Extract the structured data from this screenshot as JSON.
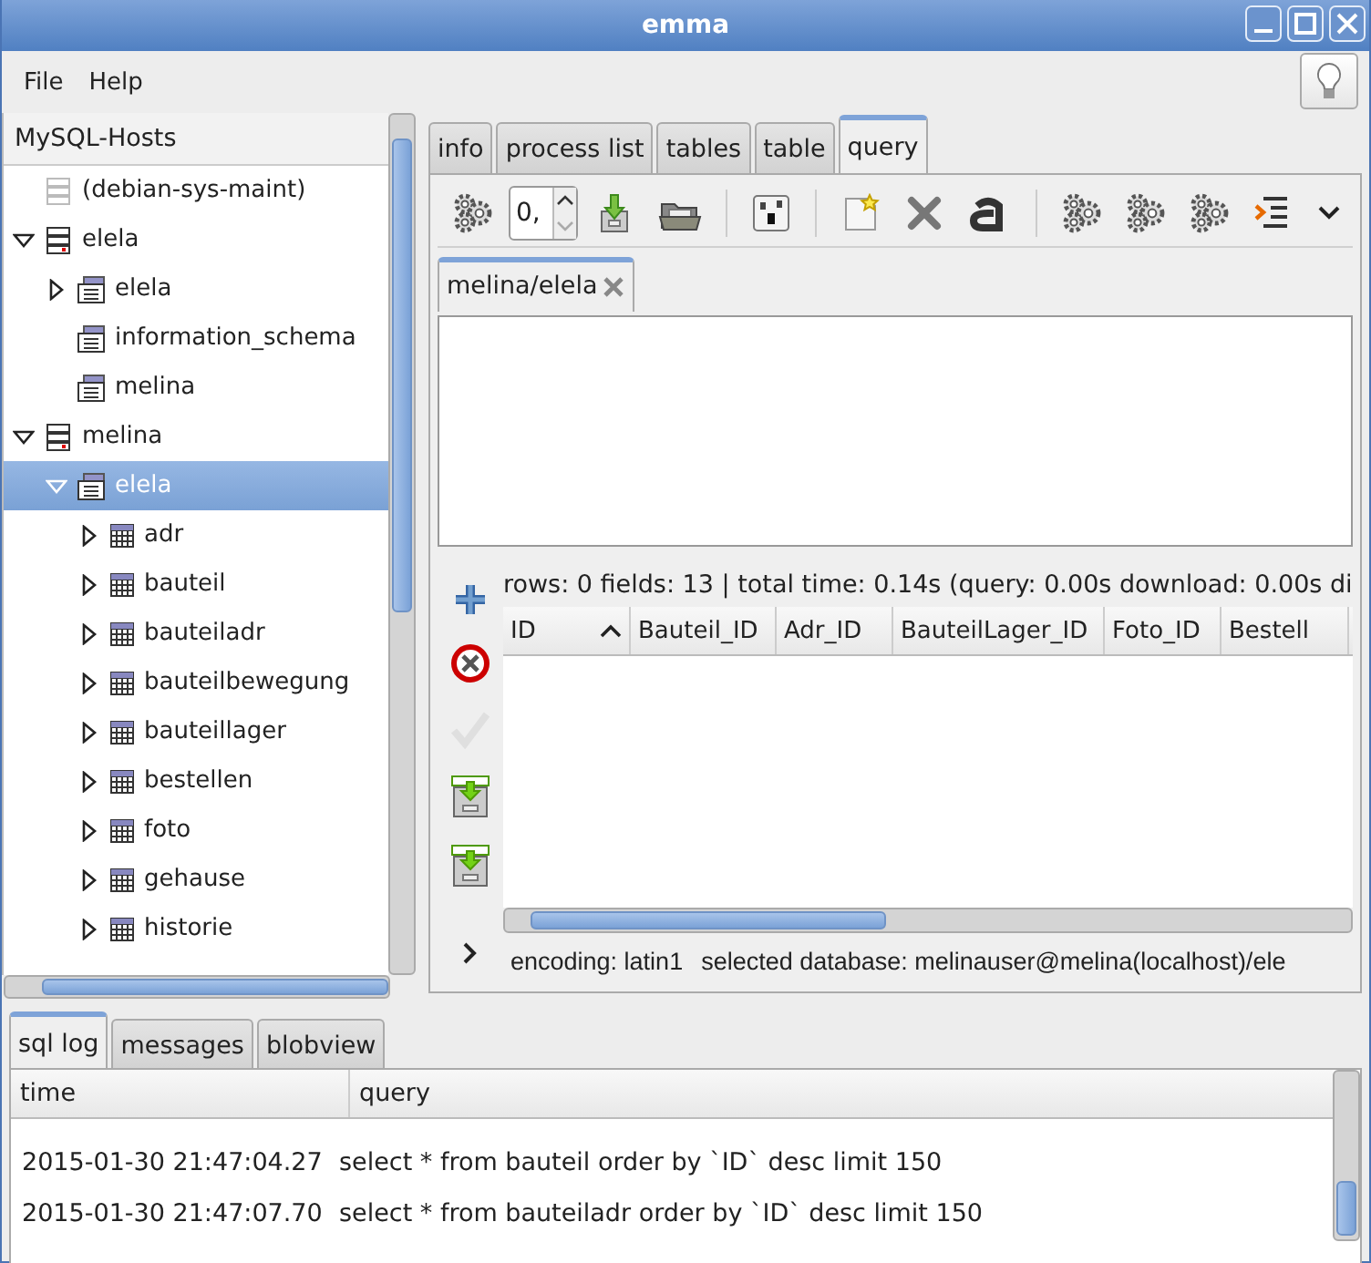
{
  "window": {
    "title": "emma"
  },
  "menu": [
    {
      "label": "File"
    },
    {
      "label": "Help"
    }
  ],
  "hosts_panel": {
    "title": "MySQL-Hosts",
    "tree": [
      {
        "label": "(debian-sys-maint)",
        "kind": "host",
        "disabled": true,
        "selected": false
      },
      {
        "label": "elela",
        "kind": "host",
        "disabled": false,
        "expanded": true,
        "selected": false,
        "children": [
          {
            "label": "elela",
            "kind": "database",
            "expanded": false,
            "selected": false
          },
          {
            "label": "information_schema",
            "kind": "database",
            "selected": false
          },
          {
            "label": "melina",
            "kind": "database",
            "selected": false
          }
        ]
      },
      {
        "label": "melina",
        "kind": "host",
        "disabled": false,
        "expanded": true,
        "selected": false,
        "children": [
          {
            "label": "elela",
            "kind": "database",
            "expanded": true,
            "selected": true,
            "children": [
              {
                "label": "adr",
                "kind": "table",
                "expanded": false,
                "selected": false
              },
              {
                "label": "bauteil",
                "kind": "table",
                "expanded": false,
                "selected": false
              },
              {
                "label": "bauteiladr",
                "kind": "table",
                "expanded": false,
                "selected": false
              },
              {
                "label": "bauteilbewegung",
                "kind": "table",
                "expanded": false,
                "selected": false
              },
              {
                "label": "bauteillager",
                "kind": "table",
                "expanded": false,
                "selected": false
              },
              {
                "label": "bestellen",
                "kind": "table",
                "expanded": false,
                "selected": false
              },
              {
                "label": "foto",
                "kind": "table",
                "expanded": false,
                "selected": false
              },
              {
                "label": "gehause",
                "kind": "table",
                "expanded": false,
                "selected": false
              },
              {
                "label": "historie",
                "kind": "table",
                "expanded": false,
                "selected": false
              }
            ]
          }
        ]
      }
    ]
  },
  "main_tabs": [
    {
      "label": "info",
      "selected": false
    },
    {
      "label": "process list",
      "selected": false
    },
    {
      "label": "tables",
      "selected": false
    },
    {
      "label": "table",
      "selected": false
    },
    {
      "label": "query",
      "selected": true
    }
  ],
  "toolbar": [
    {
      "kind": "gear"
    },
    {
      "kind": "spin",
      "value": "0,"
    },
    {
      "kind": "save"
    },
    {
      "kind": "folder"
    },
    {
      "kind": "separator"
    },
    {
      "kind": "textcase"
    },
    {
      "kind": "separator"
    },
    {
      "kind": "new"
    },
    {
      "kind": "delete"
    },
    {
      "kind": "format"
    },
    {
      "kind": "separator"
    },
    {
      "kind": "gear"
    },
    {
      "kind": "gear"
    },
    {
      "kind": "gear"
    },
    {
      "kind": "indent"
    },
    {
      "kind": "more"
    }
  ],
  "query_tabs": [
    {
      "label": "melina/elela",
      "selected": true
    }
  ],
  "result": {
    "status": "rows: 0 fields: 13 | total time: 0.14s (query: 0.00s download: 0.00s di",
    "side_buttons": [
      {
        "kind": "add",
        "disabled": false
      },
      {
        "kind": "remove",
        "disabled": false
      },
      {
        "kind": "apply",
        "disabled": true
      },
      {
        "kind": "import",
        "disabled": false
      },
      {
        "kind": "import",
        "disabled": false
      },
      {
        "kind": "expand",
        "disabled": false
      }
    ],
    "columns": [
      {
        "label": "ID",
        "sorted": true
      },
      {
        "label": "Bauteil_ID"
      },
      {
        "label": "Adr_ID"
      },
      {
        "label": "BauteilLager_ID"
      },
      {
        "label": "Foto_ID"
      },
      {
        "label": "Bestell"
      }
    ],
    "encoding": "encoding: latin1",
    "database": "selected database: melinauser@melina(localhost)/ele"
  },
  "bottom_tabs": [
    {
      "label": "sql log",
      "selected": true
    },
    {
      "label": "messages",
      "selected": false
    },
    {
      "label": "blobview",
      "selected": false
    }
  ],
  "sql_log": {
    "columns": [
      "time",
      "query"
    ],
    "rows": [
      {
        "time": "2015-01-30 21:47:04.27",
        "query": "select * from bauteil order by `ID` desc limit 150"
      },
      {
        "time": "2015-01-30 21:47:07.70",
        "query": "select * from bauteiladr order by `ID` desc limit 150"
      }
    ]
  }
}
